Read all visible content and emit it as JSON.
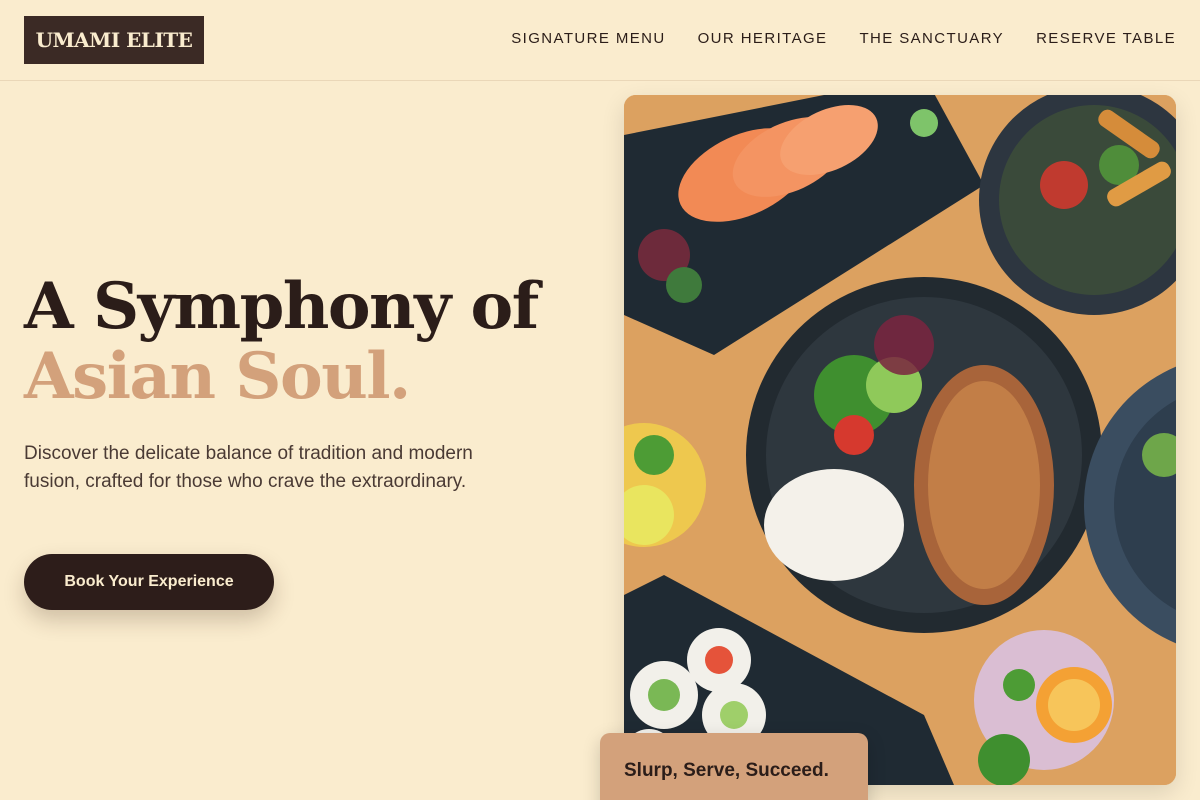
{
  "brand": {
    "logo_text": "UMAMI ELITE"
  },
  "nav": {
    "items": [
      {
        "label": "SIGNATURE MENU"
      },
      {
        "label": "OUR HERITAGE"
      },
      {
        "label": "THE SANCTUARY"
      },
      {
        "label": "RESERVE TABLE"
      }
    ]
  },
  "hero": {
    "headline_line1": "A Symphony of",
    "headline_line2": "Asian Soul.",
    "subtext": "Discover the delicate balance of tradition and modern fusion, crafted for those who crave the extraordinary.",
    "cta_label": "Book Your Experience"
  },
  "image": {
    "alt": "Overhead view of sashimi, a rice bowl with fried cutlet and salad, sushi rolls, and cocktails on a wooden table"
  },
  "tagline": "Slurp, Serve, Succeed.",
  "colors": {
    "background": "#faecce",
    "dark_brown": "#2b1d19",
    "accent_tan": "#d3a17b"
  }
}
